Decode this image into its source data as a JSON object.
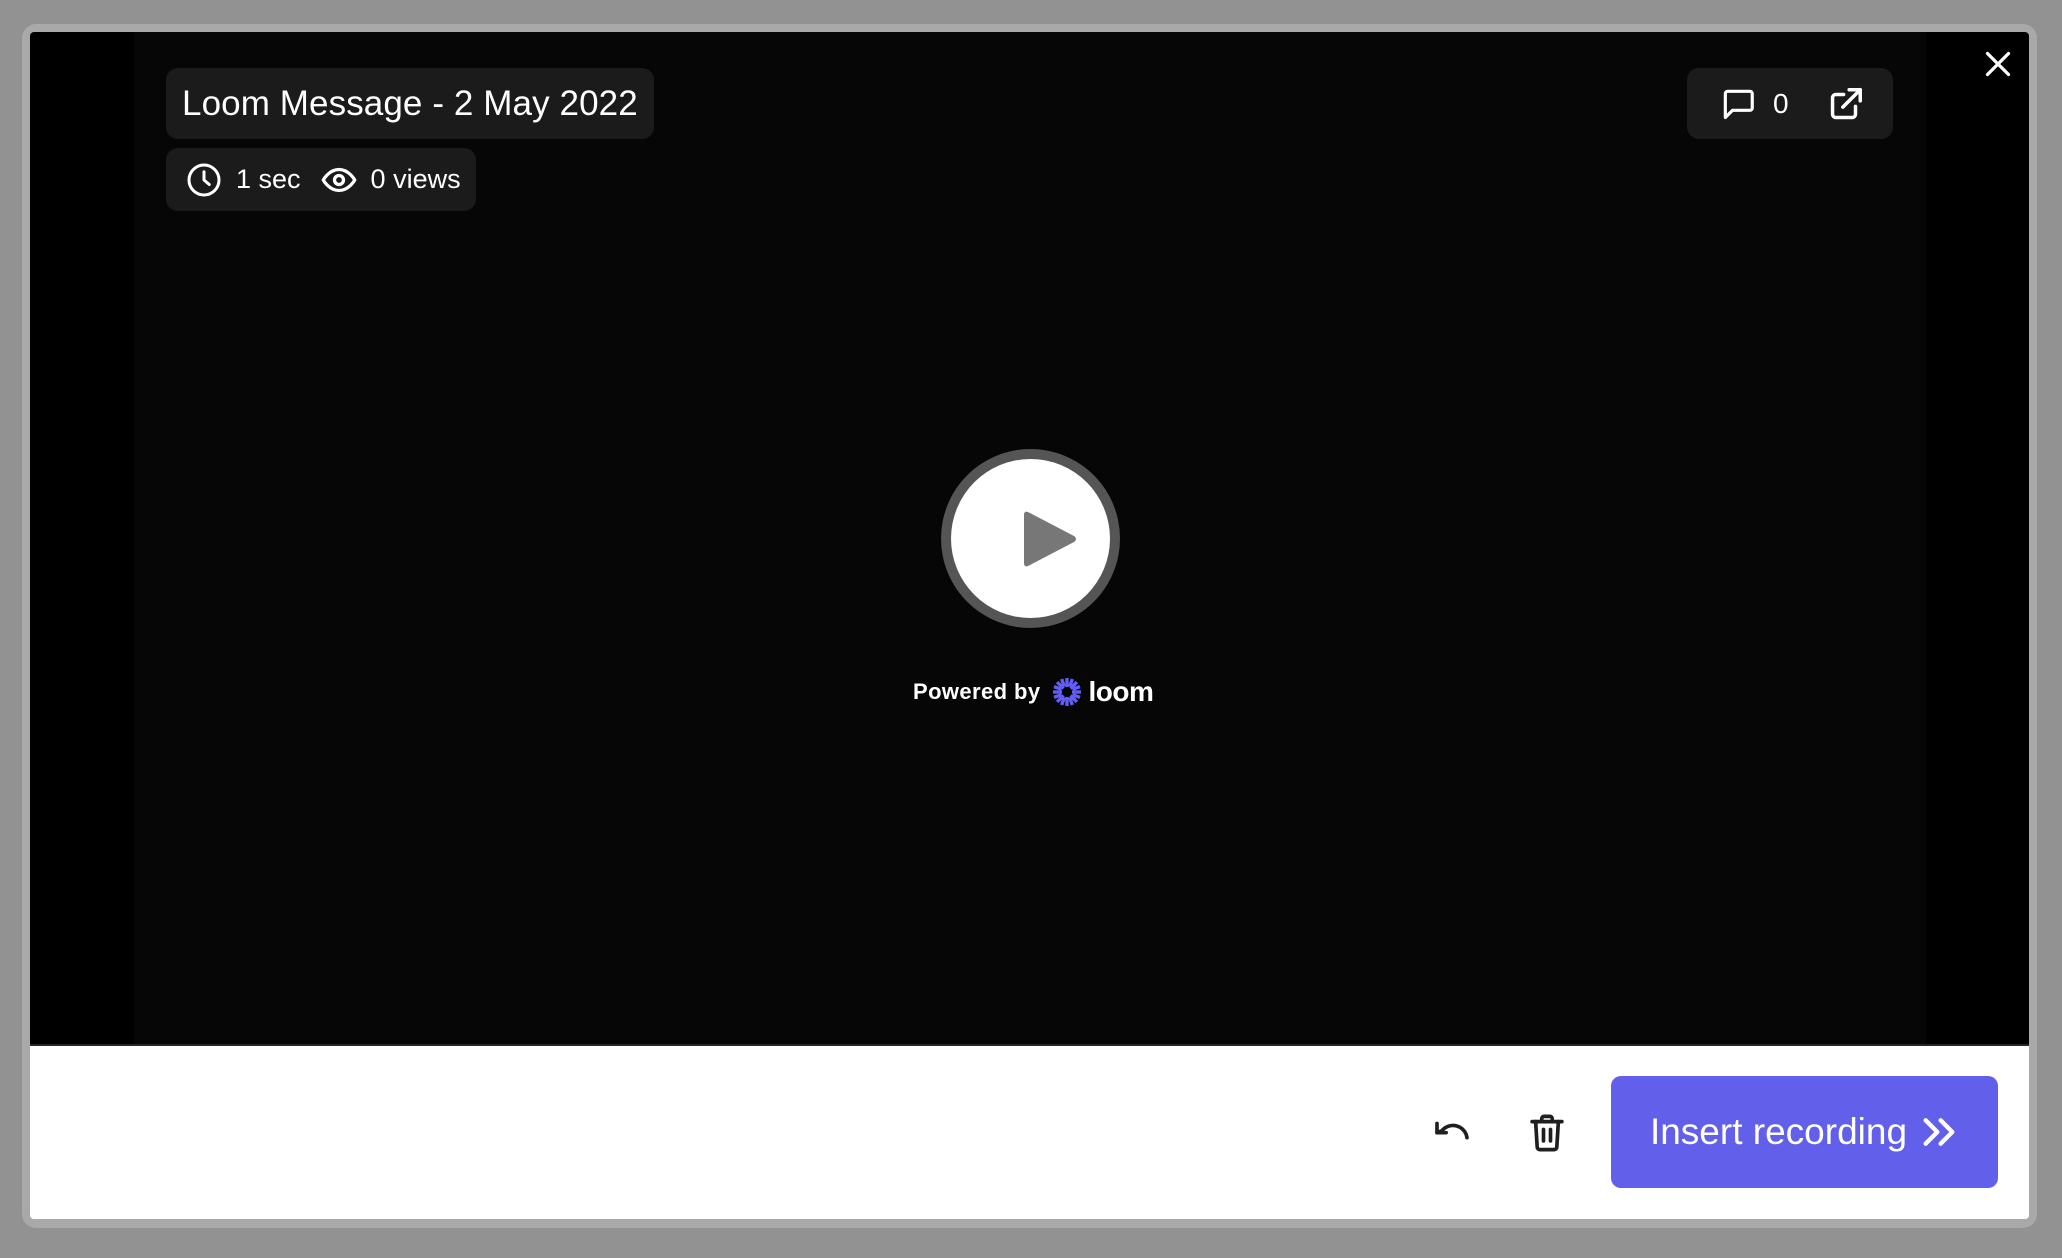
{
  "video": {
    "title": "Loom Message - 2 May 2022",
    "duration": "1 sec",
    "views": "0 views",
    "comment_count": "0",
    "icons": {
      "duration": "clock-icon",
      "views": "eye-icon",
      "comments": "comment-icon",
      "open_external": "external-link-icon",
      "close": "close-icon",
      "play": "play-icon"
    },
    "powered_by_label": "Powered by",
    "brand_name": "loom"
  },
  "footer": {
    "undo_icon": "undo-icon",
    "delete_icon": "trash-icon",
    "insert_label": "Insert recording",
    "insert_icon": "double-chevron-right-icon"
  },
  "colors": {
    "accent": "#625FEB",
    "brand": "#625DF5",
    "pill_bg": "#1B1B1B",
    "video_bg": "#060606",
    "overlay": "#929292"
  }
}
